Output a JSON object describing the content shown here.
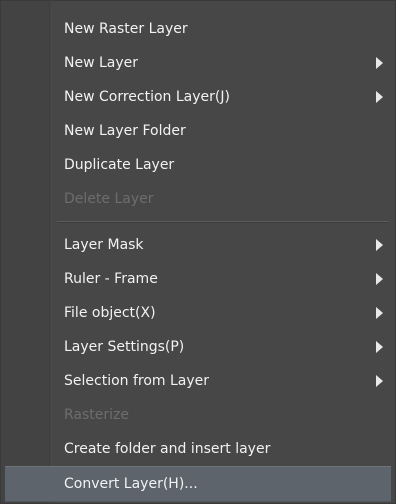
{
  "menu": {
    "items": [
      {
        "label": "New Raster Layer"
      },
      {
        "label": "New Layer",
        "submenu_icon": "chevron-right-icon"
      },
      {
        "label": "New Correction Layer(J)",
        "submenu_icon": "chevron-right-icon"
      },
      {
        "label": "New Layer Folder"
      },
      {
        "label": "Duplicate Layer"
      },
      {
        "label": "Delete Layer",
        "disabled": true
      },
      {
        "label": "Layer Mask",
        "submenu_icon": "chevron-right-icon"
      },
      {
        "label": "Ruler - Frame",
        "submenu_icon": "chevron-right-icon"
      },
      {
        "label": "File object(X)",
        "submenu_icon": "chevron-right-icon"
      },
      {
        "label": "Layer Settings(P)",
        "submenu_icon": "chevron-right-icon"
      },
      {
        "label": "Selection from Layer",
        "submenu_icon": "chevron-right-icon"
      },
      {
        "label": "Rasterize",
        "disabled": true
      },
      {
        "label": "Create folder and insert layer"
      },
      {
        "label": "Convert Layer(H)...",
        "highlighted": true
      }
    ]
  },
  "colors": {
    "menu_background": "#474747",
    "text": "#f2f2f2",
    "disabled_text": "#6d6d6d",
    "highlight": "#5d646c"
  }
}
